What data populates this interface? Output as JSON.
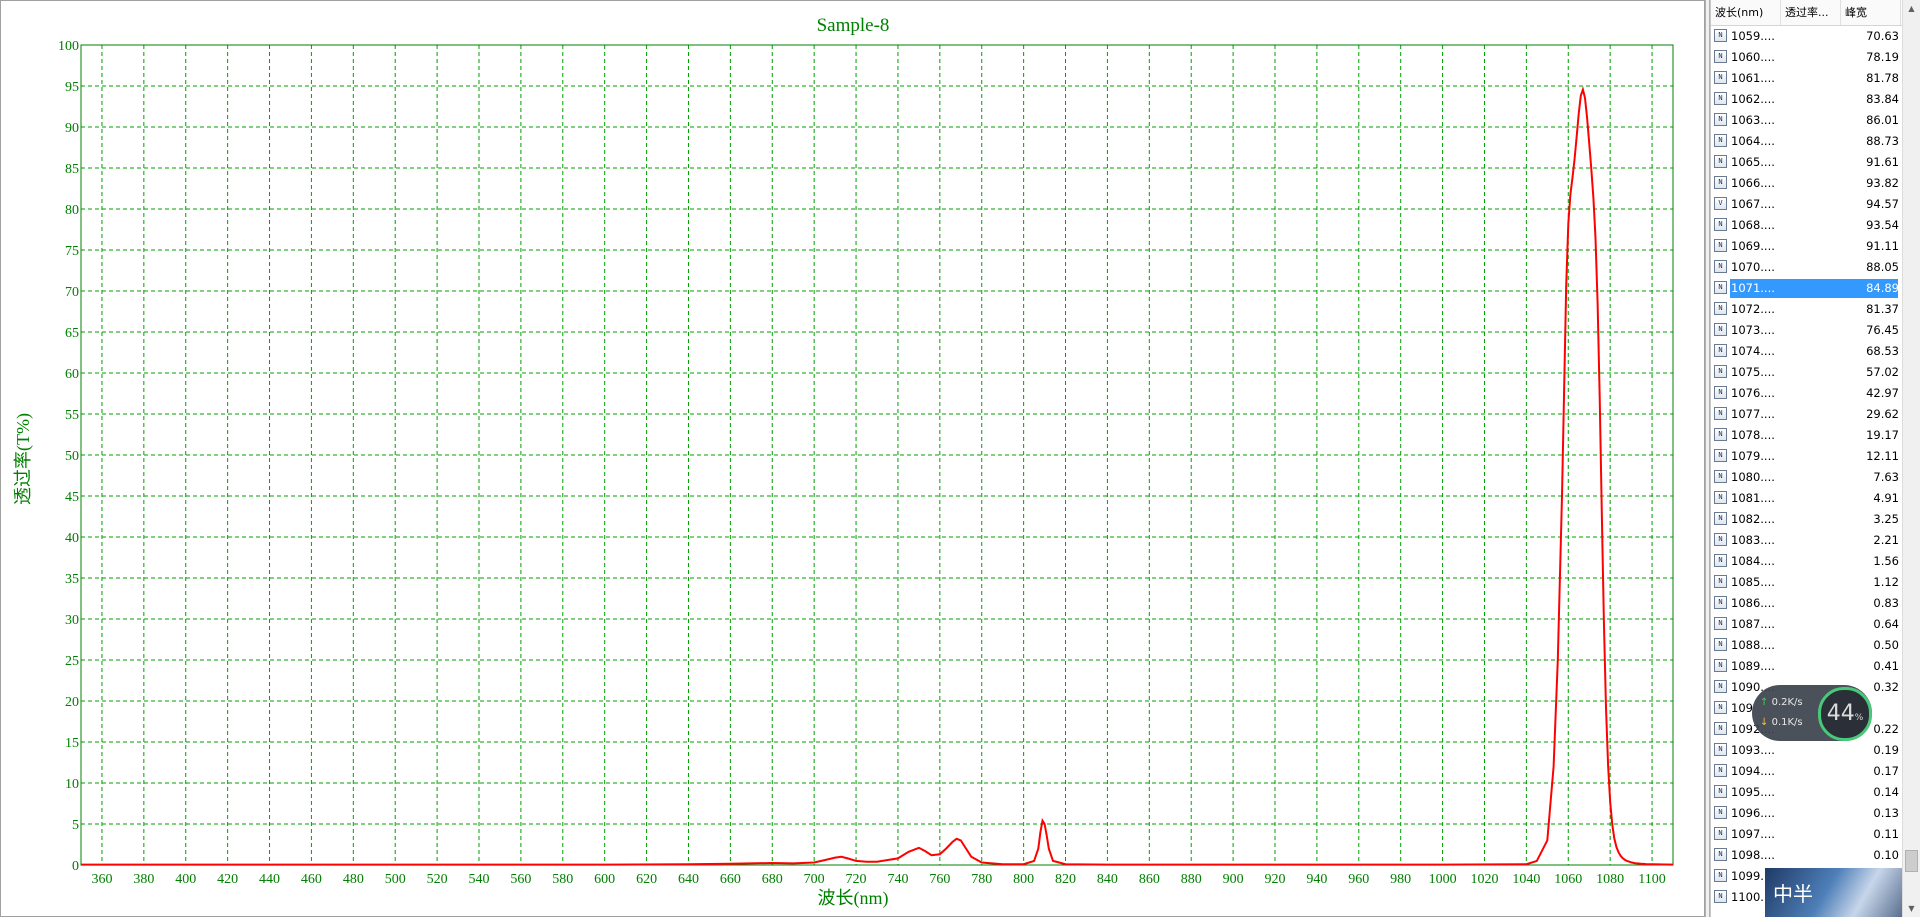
{
  "chart_data": {
    "type": "line",
    "title": "Sample-8",
    "xlabel": "波长(nm)",
    "ylabel": "透过率(T%)",
    "xlim": [
      350,
      1110
    ],
    "ylim": [
      0,
      100
    ],
    "x_ticks": [
      360,
      380,
      400,
      420,
      440,
      460,
      480,
      500,
      520,
      540,
      560,
      580,
      600,
      620,
      640,
      660,
      680,
      700,
      720,
      740,
      760,
      780,
      800,
      820,
      840,
      860,
      880,
      900,
      920,
      940,
      960,
      980,
      1000,
      1020,
      1040,
      1060,
      1080,
      1100
    ],
    "y_ticks": [
      0,
      5,
      10,
      15,
      20,
      25,
      30,
      35,
      40,
      45,
      50,
      55,
      60,
      65,
      70,
      75,
      80,
      85,
      90,
      95,
      100
    ],
    "grid": true,
    "colors": {
      "axis": "#008000",
      "grid": "#00a000",
      "series": "#ff0000"
    },
    "series": [
      {
        "x": [
          350,
          600,
          640,
          660,
          680,
          690,
          700,
          705,
          710,
          713,
          716,
          720,
          725,
          730,
          740,
          745,
          750,
          753,
          756,
          760,
          763,
          766,
          768,
          770,
          772,
          775,
          780,
          790,
          800,
          805,
          807,
          808,
          809,
          810,
          811,
          812,
          814,
          820,
          840,
          1000,
          1040,
          1045,
          1050,
          1053,
          1055,
          1057,
          1059,
          1060,
          1061,
          1062,
          1063,
          1064,
          1065,
          1066,
          1067,
          1068,
          1069,
          1070,
          1071,
          1072,
          1073,
          1074,
          1075,
          1076,
          1077,
          1078,
          1079,
          1080,
          1081,
          1082,
          1083,
          1084,
          1085,
          1086,
          1087,
          1088,
          1089,
          1090,
          1092,
          1093,
          1094,
          1095,
          1096,
          1097,
          1098,
          1100,
          1110
        ],
        "y": [
          0.05,
          0.05,
          0.1,
          0.15,
          0.25,
          0.2,
          0.3,
          0.6,
          0.9,
          1.0,
          0.8,
          0.5,
          0.4,
          0.4,
          0.8,
          1.6,
          2.1,
          1.7,
          1.2,
          1.3,
          2.0,
          2.8,
          3.2,
          3.0,
          2.2,
          1.0,
          0.3,
          0.1,
          0.1,
          0.5,
          2.0,
          4.0,
          5.4,
          5.0,
          3.6,
          2.0,
          0.5,
          0.1,
          0.05,
          0.05,
          0.1,
          0.5,
          3.0,
          12.0,
          25.0,
          45.0,
          70.63,
          78.19,
          81.78,
          83.84,
          86.01,
          88.73,
          91.61,
          93.82,
          94.57,
          93.54,
          91.11,
          88.05,
          84.89,
          81.37,
          76.45,
          68.53,
          57.02,
          42.97,
          29.62,
          19.17,
          12.11,
          7.63,
          4.91,
          3.25,
          2.21,
          1.56,
          1.12,
          0.83,
          0.64,
          0.5,
          0.41,
          0.32,
          0.22,
          0.19,
          0.17,
          0.14,
          0.13,
          0.11,
          0.1,
          0.08,
          0.05
        ]
      }
    ]
  },
  "table": {
    "headers": [
      "波长(nm)",
      "透过率...",
      "峰宽"
    ],
    "selected_index": 12,
    "rows": [
      {
        "wl": "1059....",
        "t": "70.63",
        "icon": "N"
      },
      {
        "wl": "1060....",
        "t": "78.19",
        "icon": "N"
      },
      {
        "wl": "1061....",
        "t": "81.78",
        "icon": "N"
      },
      {
        "wl": "1062....",
        "t": "83.84",
        "icon": "N"
      },
      {
        "wl": "1063....",
        "t": "86.01",
        "icon": "N"
      },
      {
        "wl": "1064....",
        "t": "88.73",
        "icon": "N"
      },
      {
        "wl": "1065....",
        "t": "91.61",
        "icon": "N"
      },
      {
        "wl": "1066....",
        "t": "93.82",
        "icon": "N"
      },
      {
        "wl": "1067....",
        "t": "94.57",
        "icon": "V"
      },
      {
        "wl": "1068....",
        "t": "93.54",
        "icon": "N"
      },
      {
        "wl": "1069....",
        "t": "91.11",
        "icon": "N"
      },
      {
        "wl": "1070....",
        "t": "88.05",
        "icon": "N"
      },
      {
        "wl": "1071....",
        "t": "84.89",
        "icon": "N"
      },
      {
        "wl": "1072....",
        "t": "81.37",
        "icon": "N"
      },
      {
        "wl": "1073....",
        "t": "76.45",
        "icon": "N"
      },
      {
        "wl": "1074....",
        "t": "68.53",
        "icon": "N"
      },
      {
        "wl": "1075....",
        "t": "57.02",
        "icon": "N"
      },
      {
        "wl": "1076....",
        "t": "42.97",
        "icon": "N"
      },
      {
        "wl": "1077....",
        "t": "29.62",
        "icon": "N"
      },
      {
        "wl": "1078....",
        "t": "19.17",
        "icon": "N"
      },
      {
        "wl": "1079....",
        "t": "12.11",
        "icon": "N"
      },
      {
        "wl": "1080....",
        "t": "7.63",
        "icon": "N"
      },
      {
        "wl": "1081....",
        "t": "4.91",
        "icon": "N"
      },
      {
        "wl": "1082....",
        "t": "3.25",
        "icon": "N"
      },
      {
        "wl": "1083....",
        "t": "2.21",
        "icon": "N"
      },
      {
        "wl": "1084....",
        "t": "1.56",
        "icon": "N"
      },
      {
        "wl": "1085....",
        "t": "1.12",
        "icon": "N"
      },
      {
        "wl": "1086....",
        "t": "0.83",
        "icon": "N"
      },
      {
        "wl": "1087....",
        "t": "0.64",
        "icon": "N"
      },
      {
        "wl": "1088....",
        "t": "0.50",
        "icon": "N"
      },
      {
        "wl": "1089....",
        "t": "0.41",
        "icon": "N"
      },
      {
        "wl": "1090....",
        "t": "0.32",
        "icon": "N"
      },
      {
        "wl": "109",
        "t": "",
        "icon": "N"
      },
      {
        "wl": "1092....",
        "t": "0.22",
        "icon": "N"
      },
      {
        "wl": "1093....",
        "t": "0.19",
        "icon": "N"
      },
      {
        "wl": "1094....",
        "t": "0.17",
        "icon": "N"
      },
      {
        "wl": "1095....",
        "t": "0.14",
        "icon": "N"
      },
      {
        "wl": "1096....",
        "t": "0.13",
        "icon": "N"
      },
      {
        "wl": "1097....",
        "t": "0.11",
        "icon": "N"
      },
      {
        "wl": "1098....",
        "t": "0.10",
        "icon": "N"
      },
      {
        "wl": "1099....",
        "t": "",
        "icon": "N"
      },
      {
        "wl": "1100....",
        "t": "",
        "icon": "N"
      }
    ]
  },
  "net_widget": {
    "upload": "0.2K/s",
    "download": "0.1K/s",
    "gauge_value": "44",
    "gauge_unit": "%"
  },
  "ime": {
    "label": "中半"
  },
  "icons": {
    "row_icon": "spectrum-row-icon",
    "scroll_up": "scroll-up-arrow-icon",
    "scroll_down": "scroll-down-arrow-icon"
  }
}
